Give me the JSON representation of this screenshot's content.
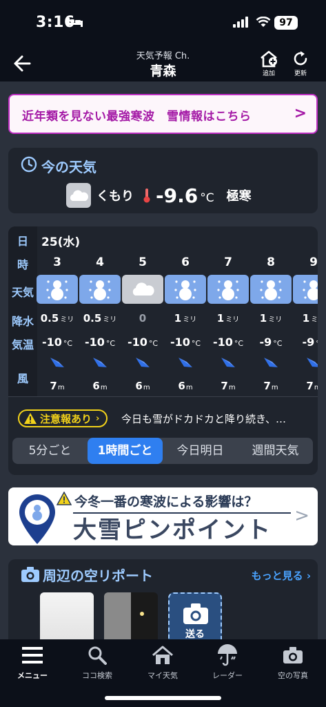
{
  "status_bar": {
    "time": "3:16",
    "battery": "97"
  },
  "header": {
    "subtitle": "天気予報 Ch.",
    "title": "青森",
    "add_label": "追加",
    "refresh_label": "更新"
  },
  "promo": {
    "text": "近年類を見ない最強寒波　雪情報はこちら"
  },
  "now": {
    "title": "今の天気",
    "condition": "くもり",
    "temperature": "-9.6",
    "unit": "°C",
    "level": "極寒"
  },
  "hourly": {
    "row_labels": {
      "day": "日",
      "hour": "時",
      "weather": "天気",
      "precip": "降水",
      "temp": "気温",
      "wind": "風"
    },
    "date": "25(水)",
    "hours": [
      {
        "hour": "3",
        "weather": "snow",
        "precip": "0.5",
        "precip_unit": "ミリ",
        "temp": "-10",
        "temp_unit": "°C",
        "wind": "7",
        "wind_unit": "m"
      },
      {
        "hour": "4",
        "weather": "snow",
        "precip": "0.5",
        "precip_unit": "ミリ",
        "temp": "-10",
        "temp_unit": "°C",
        "wind": "6",
        "wind_unit": "m"
      },
      {
        "hour": "5",
        "weather": "cloud",
        "precip": "0",
        "precip_unit": "",
        "temp": "-10",
        "temp_unit": "°C",
        "wind": "6",
        "wind_unit": "m"
      },
      {
        "hour": "6",
        "weather": "snow",
        "precip": "1",
        "precip_unit": "ミリ",
        "temp": "-10",
        "temp_unit": "°C",
        "wind": "6",
        "wind_unit": "m"
      },
      {
        "hour": "7",
        "weather": "snow",
        "precip": "1",
        "precip_unit": "ミリ",
        "temp": "-10",
        "temp_unit": "°C",
        "wind": "7",
        "wind_unit": "m"
      },
      {
        "hour": "8",
        "weather": "snow",
        "precip": "1",
        "precip_unit": "ミリ",
        "temp": "-9",
        "temp_unit": "°C",
        "wind": "7",
        "wind_unit": "m"
      },
      {
        "hour": "9",
        "weather": "snow",
        "precip": "1",
        "precip_unit": "ミリ",
        "temp": "-9",
        "temp_unit": "°C",
        "wind": "7",
        "wind_unit": "m"
      }
    ],
    "alert_label": "注意報あり",
    "alert_chevron": "›",
    "alert_text": "今日も雪がドカドカと降り続き、…",
    "segments": [
      "5分ごと",
      "1時間ごと",
      "今日明日",
      "週間天気"
    ],
    "active_segment": "1時間ごと"
  },
  "banner": {
    "question": "今冬一番の寒波による影響は？",
    "headline": "大雪ピンポイント"
  },
  "sky_report": {
    "title": "周辺の空リポート",
    "more": "もっと見る",
    "send_label": "送る"
  },
  "bottom_nav": [
    {
      "label": "メニュー",
      "icon": "menu-icon",
      "active": true
    },
    {
      "label": "ココ検索",
      "icon": "search-icon",
      "active": false
    },
    {
      "label": "マイ天気",
      "icon": "home-icon",
      "active": false
    },
    {
      "label": "レーダー",
      "icon": "radar-umbrella-icon",
      "active": false
    },
    {
      "label": "空の写真",
      "icon": "camera-icon",
      "active": false
    }
  ],
  "colors": {
    "accent_blue": "#2f7ff0",
    "header_blue": "#9ecbff",
    "promo_purple": "#a41aa6",
    "alert_yellow": "#f2d21a"
  }
}
